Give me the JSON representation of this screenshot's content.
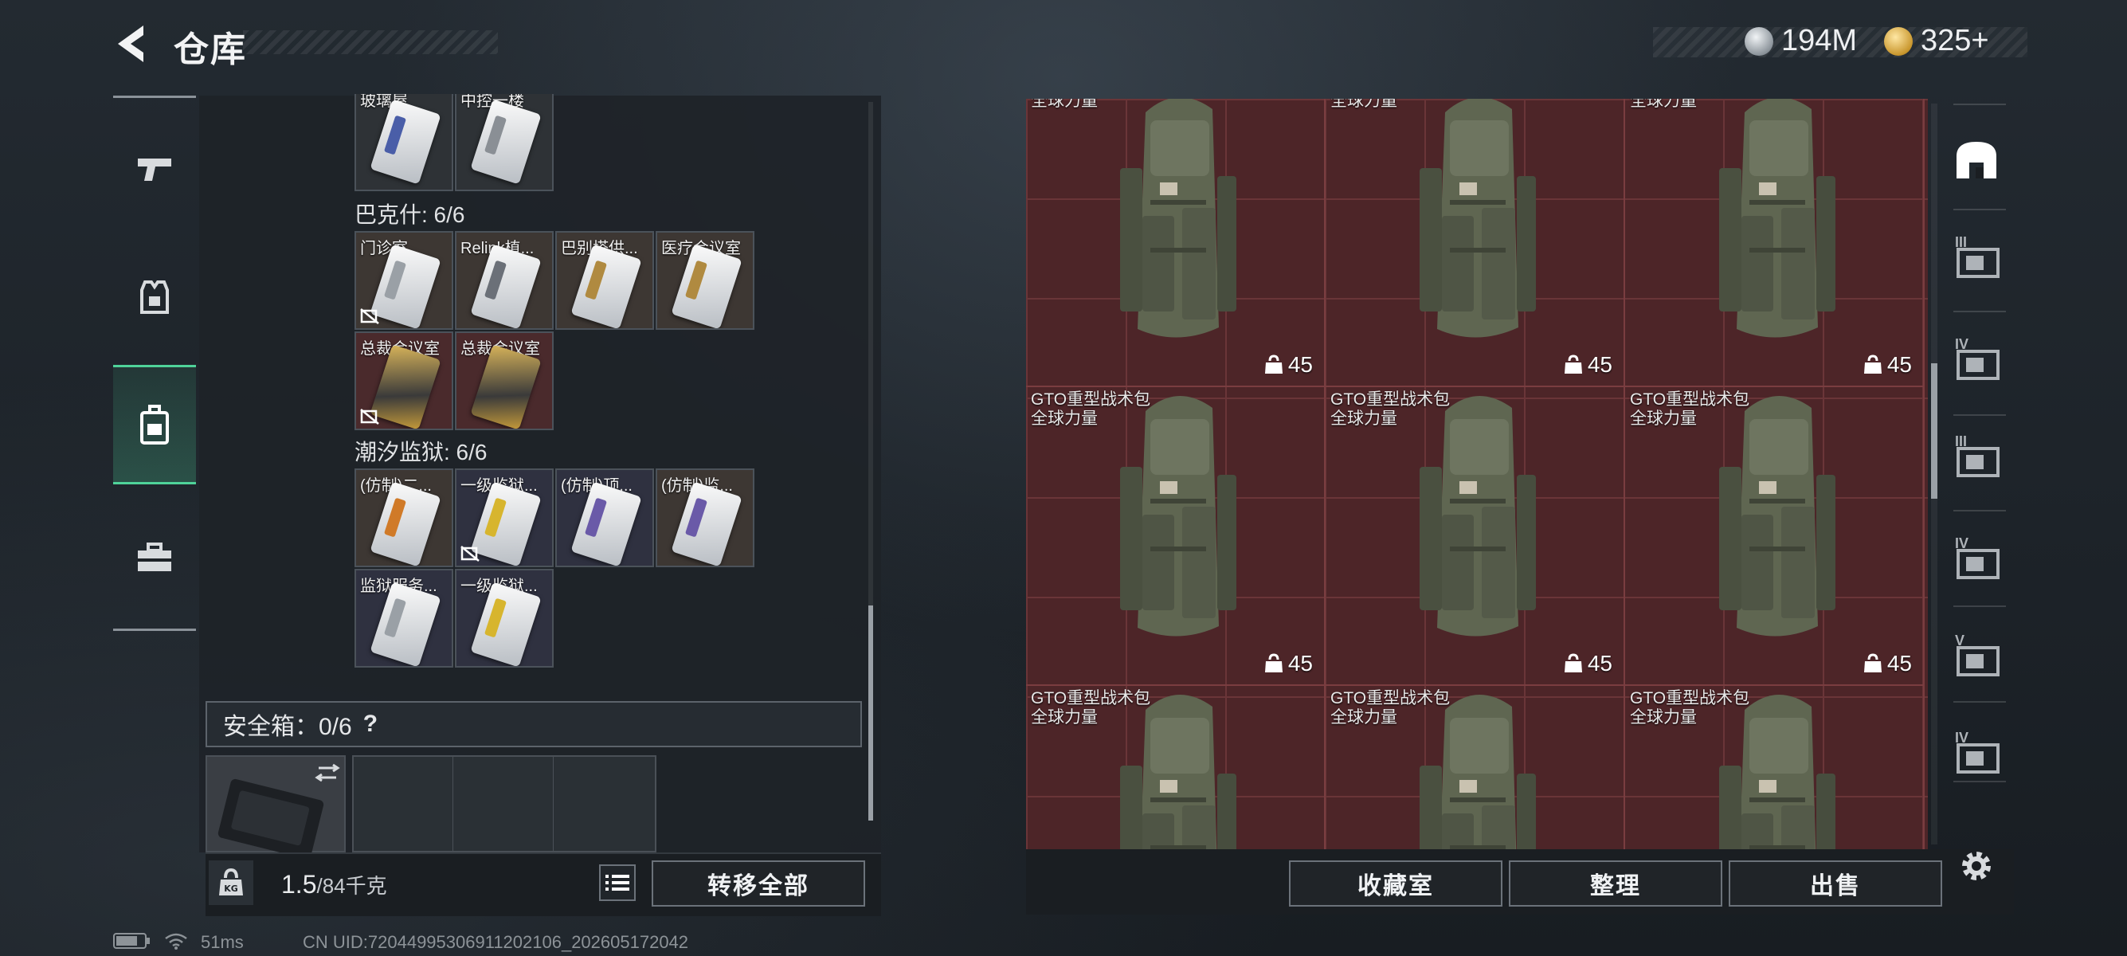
{
  "header": {
    "title": "仓库",
    "currency": [
      {
        "icon": "silver-coin-icon",
        "value": "194M",
        "color": "#c8ced4"
      },
      {
        "icon": "gold-coin-icon",
        "value": "325+",
        "color": "#d9b24a"
      }
    ]
  },
  "left_nav": [
    {
      "icon": "pistol-icon",
      "active": false
    },
    {
      "icon": "armor-vest-icon",
      "active": false
    },
    {
      "icon": "backpack-icon",
      "active": true
    },
    {
      "icon": "toolbox-icon",
      "active": false
    }
  ],
  "inventory": {
    "top_partial": [
      "玻璃屋",
      "中控一楼"
    ],
    "groups": [
      {
        "label": "巴克什: 6/6",
        "items": [
          {
            "name": "门诊室",
            "bg": "brown",
            "card": "white",
            "locked": true
          },
          {
            "name": "Relink植...",
            "bg": "brown",
            "card": "white",
            "locked": false
          },
          {
            "name": "巴别塔供...",
            "bg": "brown",
            "card": "white",
            "locked": false
          },
          {
            "name": "医疗会议室",
            "bg": "brown",
            "card": "white",
            "locked": false
          },
          {
            "name": "总裁会议室",
            "bg": "red",
            "card": "gold",
            "locked": true
          },
          {
            "name": "总裁会议室",
            "bg": "red",
            "card": "gold",
            "locked": false
          }
        ]
      },
      {
        "label": "潮汐监狱: 6/6",
        "items": [
          {
            "name": "(仿制)二...",
            "bg": "brown",
            "card": "orange",
            "locked": false
          },
          {
            "name": "一级监狱...",
            "bg": "navy",
            "card": "yellow",
            "locked": true
          },
          {
            "name": "(仿制)顶...",
            "bg": "navy",
            "card": "purple",
            "locked": false
          },
          {
            "name": "(仿制)监...",
            "bg": "brown",
            "card": "purple",
            "locked": false
          },
          {
            "name": "监狱服务...",
            "bg": "navy",
            "card": "white",
            "locked": false
          },
          {
            "name": "一级监狱...",
            "bg": "navy",
            "card": "yellow",
            "locked": false
          }
        ]
      }
    ],
    "secure_box": {
      "label": "安全箱：0/6",
      "help": "?"
    },
    "weight": {
      "current": "1.5",
      "max": "/84千克"
    },
    "transfer_all": "转移全部"
  },
  "stash": {
    "items": [
      {
        "name": "",
        "sub": "全球力量",
        "count": "45"
      },
      {
        "name": "",
        "sub": "全球力量",
        "count": "45"
      },
      {
        "name": "",
        "sub": "全球力量",
        "count": "45"
      },
      {
        "name": "GTO重型战术包",
        "sub": "全球力量",
        "count": "45"
      },
      {
        "name": "GTO重型战术包",
        "sub": "全球力量",
        "count": "45"
      },
      {
        "name": "GTO重型战术包",
        "sub": "全球力量",
        "count": "45"
      },
      {
        "name": "GTO重型战术包",
        "sub": "全球力量",
        "count": ""
      },
      {
        "name": "GTO重型战术包",
        "sub": "全球力量",
        "count": ""
      },
      {
        "name": "GTO重型战术包",
        "sub": "全球力量",
        "count": ""
      }
    ],
    "buttons": {
      "collection": "收藏室",
      "sort": "整理",
      "sell": "出售"
    }
  },
  "right_nav": [
    {
      "icon": "stash-home-icon",
      "label": ""
    },
    {
      "icon": "stash-tab-icon",
      "label": "III"
    },
    {
      "icon": "stash-tab-icon",
      "label": "IV"
    },
    {
      "icon": "stash-tab-icon",
      "label": "III"
    },
    {
      "icon": "stash-tab-icon",
      "label": "IV"
    },
    {
      "icon": "stash-tab-icon",
      "label": "V"
    },
    {
      "icon": "stash-tab-icon",
      "label": "IV"
    },
    {
      "icon": "gear-icon",
      "label": ""
    }
  ],
  "status_bar": {
    "ping": "51ms",
    "uid": "CN UID:7204499530691120210​6_202605172042"
  }
}
